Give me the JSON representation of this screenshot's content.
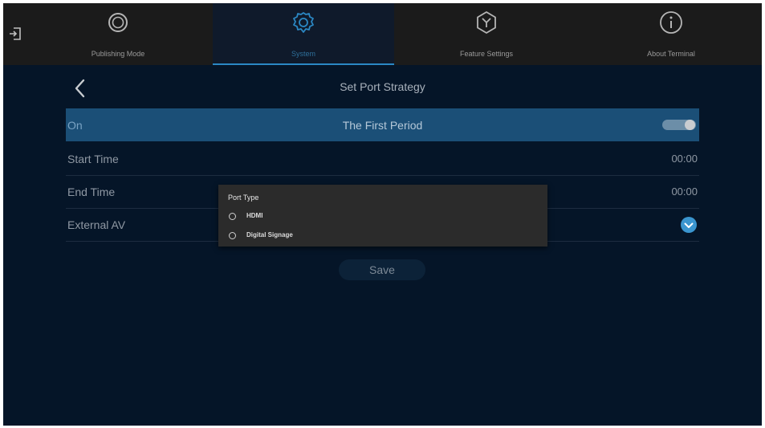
{
  "nav": {
    "tabs": [
      {
        "label": "Publishing Mode",
        "icon": "publishing-mode-icon"
      },
      {
        "label": "System",
        "icon": "gear-icon",
        "active": true
      },
      {
        "label": "Feature Settings",
        "icon": "feature-settings-icon"
      },
      {
        "label": "About Terminal",
        "icon": "info-icon"
      }
    ],
    "exit_icon": "exit-icon"
  },
  "header": {
    "title": "Set Port Strategy",
    "back_icon": "back-chevron-icon"
  },
  "period": {
    "state_label": "On",
    "title": "The First Period",
    "toggle_on": true
  },
  "rows": {
    "start_time": {
      "label": "Start Time",
      "value": "00:00"
    },
    "end_time": {
      "label": "End Time",
      "value": "00:00"
    },
    "external_av": {
      "label": "External AV",
      "checked": true
    }
  },
  "save_label": "Save",
  "dialog": {
    "title": "Port Type",
    "options": [
      {
        "label": "HDMI",
        "selected": false
      },
      {
        "label": "Digital Signage",
        "selected": false
      }
    ]
  },
  "colors": {
    "background": "#051528",
    "accent": "#2b88c4",
    "highlight_row": "#1b4f77",
    "dialog": "#2b2b2b"
  }
}
